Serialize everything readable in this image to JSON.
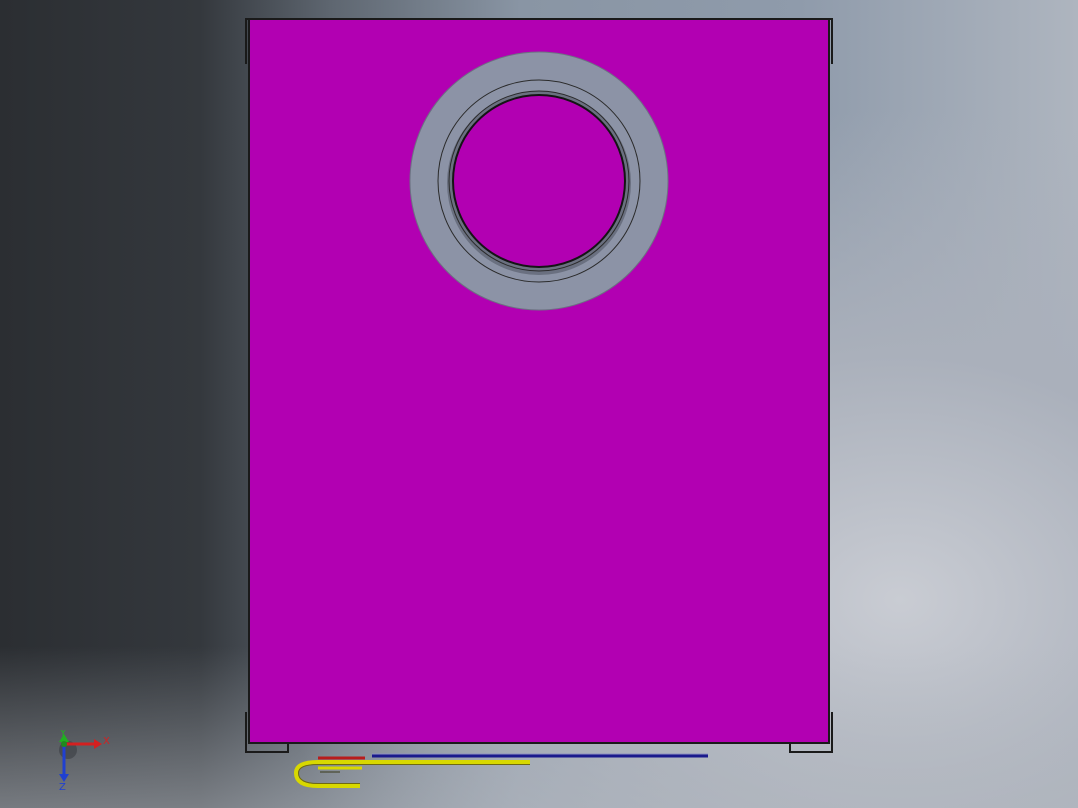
{
  "viewport": {
    "background_top_left": "#2b2e32",
    "background_right": "#aeb5bf"
  },
  "model": {
    "panel_color": "#b200b2",
    "panel_edge_color": "#1a1a1a",
    "ring_color": "#8c93a6",
    "hole_color": "#b200b2",
    "wire_yellow": "#d8d800",
    "wire_blue": "#1a1a8c",
    "wire_red": "#b81c1c"
  },
  "triad": {
    "x_label": "X",
    "y_label": "Y",
    "z_label": "Z",
    "x_color": "#d42020",
    "y_color": "#20b020",
    "z_color": "#2040d0"
  }
}
